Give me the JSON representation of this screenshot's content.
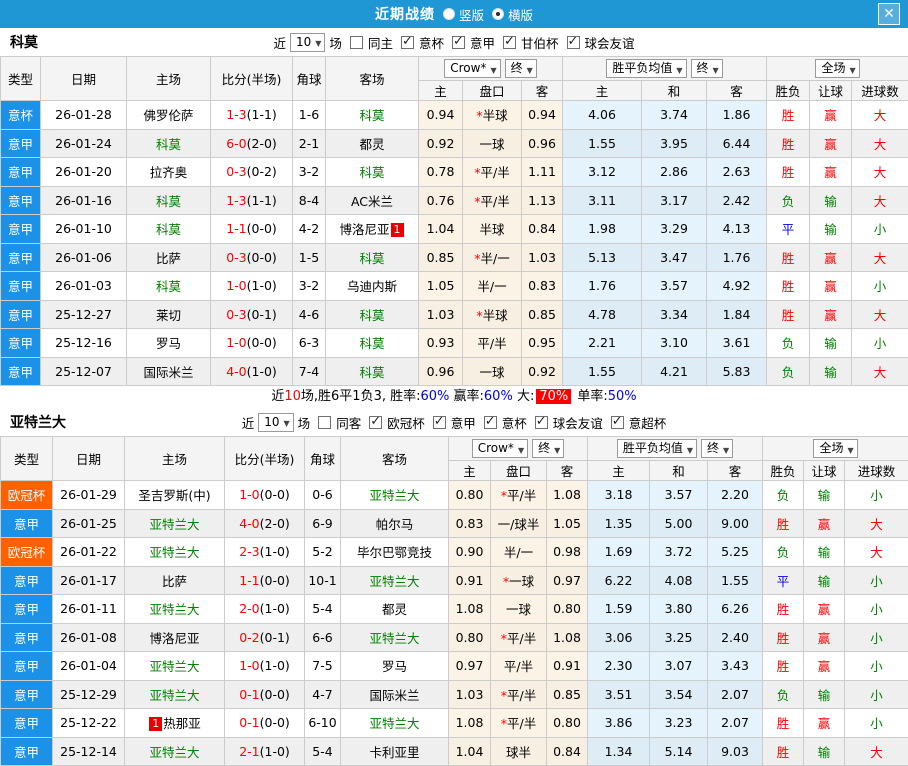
{
  "titlebar": {
    "title": "近期战绩",
    "radios": [
      {
        "label": "竖版",
        "selected": false
      },
      {
        "label": "横版",
        "selected": true
      }
    ],
    "close": "✕"
  },
  "colors": {
    "titlebar_bg": "#1e97d4",
    "header_bg": "#f4f4f4",
    "stripe_gray": "#efefef",
    "team_green": "#008000",
    "score_red": "#ff0000",
    "percent_blue": "#0000ee",
    "highlight_bg": "#ff0000",
    "league_colors": {
      "意杯": "#1b92e8",
      "意甲": "#1b92e8",
      "欧冠杯": "#ff6000"
    },
    "result_colors": {
      "胜": "#ff0000",
      "平": "#0000dd",
      "负": "#008000",
      "赢": "#ff0000",
      "输": "#008000",
      "大": "#ff0000",
      "小": "#008000"
    }
  },
  "table_header": {
    "type": "类型",
    "date": "日期",
    "home": "主场",
    "score": "比分(半场)",
    "corner": "角球",
    "away": "客场",
    "crow_select": "Crow*",
    "final_select": "终",
    "avg_select": "胜平负均值",
    "final2_select": "终",
    "fullmatch_select": "全场",
    "sub": [
      "主",
      "盘口",
      "客",
      "主",
      "和",
      "客",
      "胜负",
      "让球",
      "进球数"
    ]
  },
  "sections": [
    {
      "team": "科莫",
      "filter": {
        "near_label": "近",
        "count": "10",
        "matches_label": "场",
        "same_label": "同主",
        "same_checked": false,
        "leagues": [
          {
            "label": "意杯",
            "checked": true
          },
          {
            "label": "意甲",
            "checked": true
          },
          {
            "label": "甘伯杯",
            "checked": true
          },
          {
            "label": "球会友谊",
            "checked": true
          }
        ]
      },
      "rows": [
        {
          "lg": "意杯",
          "date": "26-01-28",
          "home": "佛罗伦萨",
          "score": "1-3",
          "half": "(1-1)",
          "corner": "1-6",
          "away": "科莫",
          "o1": "0.94",
          "star": "*",
          "hc": "半球",
          "o2": "0.94",
          "a1": "4.06",
          "a2": "3.74",
          "a3": "1.86",
          "res": "胜",
          "let": "赢",
          "goal": "大"
        },
        {
          "lg": "意甲",
          "date": "26-01-24",
          "home": "科莫",
          "score": "6-0",
          "half": "(2-0)",
          "corner": "2-1",
          "away": "都灵",
          "o1": "0.92",
          "star": "",
          "hc": "一球",
          "o2": "0.96",
          "a1": "1.55",
          "a2": "3.95",
          "a3": "6.44",
          "res": "胜",
          "let": "赢",
          "goal": "大"
        },
        {
          "lg": "意甲",
          "date": "26-01-20",
          "home": "拉齐奥",
          "score": "0-3",
          "half": "(0-2)",
          "corner": "3-2",
          "away": "科莫",
          "o1": "0.78",
          "star": "*",
          "hc": "平/半",
          "o2": "1.11",
          "a1": "3.12",
          "a2": "2.86",
          "a3": "2.63",
          "res": "胜",
          "let": "赢",
          "goal": "大"
        },
        {
          "lg": "意甲",
          "date": "26-01-16",
          "home": "科莫",
          "score": "1-3",
          "half": "(1-1)",
          "corner": "8-4",
          "away": "AC米兰",
          "o1": "0.76",
          "star": "*",
          "hc": "平/半",
          "o2": "1.13",
          "a1": "3.11",
          "a2": "3.17",
          "a3": "2.42",
          "res": "负",
          "let": "输",
          "goal": "大"
        },
        {
          "lg": "意甲",
          "date": "26-01-10",
          "home": "科莫",
          "score": "1-1",
          "half": "(0-0)",
          "corner": "4-2",
          "away": "博洛尼亚",
          "ab_post": "1",
          "o1": "1.04",
          "star": "",
          "hc": "半球",
          "o2": "0.84",
          "a1": "1.98",
          "a2": "3.29",
          "a3": "4.13",
          "res": "平",
          "let": "输",
          "goal": "小"
        },
        {
          "lg": "意甲",
          "date": "26-01-06",
          "home": "比萨",
          "score": "0-3",
          "half": "(0-0)",
          "corner": "1-5",
          "away": "科莫",
          "o1": "0.85",
          "star": "*",
          "hc": "半/一",
          "o2": "1.03",
          "a1": "5.13",
          "a2": "3.47",
          "a3": "1.76",
          "res": "胜",
          "let": "赢",
          "goal": "大"
        },
        {
          "lg": "意甲",
          "date": "26-01-03",
          "home": "科莫",
          "score": "1-0",
          "half": "(1-0)",
          "corner": "3-2",
          "away": "乌迪内斯",
          "o1": "1.05",
          "star": "",
          "hc": "半/一",
          "o2": "0.83",
          "a1": "1.76",
          "a2": "3.57",
          "a3": "4.92",
          "res": "胜",
          "let": "赢",
          "goal": "小"
        },
        {
          "lg": "意甲",
          "date": "25-12-27",
          "home": "莱切",
          "score": "0-3",
          "half": "(0-1)",
          "corner": "4-6",
          "away": "科莫",
          "o1": "1.03",
          "star": "*",
          "hc": "半球",
          "o2": "0.85",
          "a1": "4.78",
          "a2": "3.34",
          "a3": "1.84",
          "res": "胜",
          "let": "赢",
          "goal": "大"
        },
        {
          "lg": "意甲",
          "date": "25-12-16",
          "home": "罗马",
          "score": "1-0",
          "half": "(0-0)",
          "corner": "6-3",
          "away": "科莫",
          "o1": "0.93",
          "star": "",
          "hc": "平/半",
          "o2": "0.95",
          "a1": "2.21",
          "a2": "3.10",
          "a3": "3.61",
          "res": "负",
          "let": "输",
          "goal": "小"
        },
        {
          "lg": "意甲",
          "date": "25-12-07",
          "home": "国际米兰",
          "score": "4-0",
          "half": "(1-0)",
          "corner": "7-4",
          "away": "科莫",
          "o1": "0.96",
          "star": "",
          "hc": "一球",
          "o2": "0.92",
          "a1": "1.55",
          "a2": "4.21",
          "a3": "5.83",
          "res": "负",
          "let": "输",
          "goal": "大"
        }
      ],
      "summary": [
        {
          "t": "近",
          "s": "k"
        },
        {
          "t": "10",
          "s": "r"
        },
        {
          "t": "场,胜6平1负3, 胜率:",
          "s": "k"
        },
        {
          "t": "60%",
          "s": "b"
        },
        {
          "t": " 赢率:",
          "s": "k"
        },
        {
          "t": "60%",
          "s": "b"
        },
        {
          "t": " 大:",
          "s": "k"
        },
        {
          "t": "70%",
          "s": "hr"
        },
        {
          "t": " 单率:",
          "s": "k"
        },
        {
          "t": "50%",
          "s": "b"
        }
      ]
    },
    {
      "team": "亚特兰大",
      "filter": {
        "near_label": "近",
        "count": "10",
        "matches_label": "场",
        "same_label": "同客",
        "same_checked": false,
        "leagues": [
          {
            "label": "欧冠杯",
            "checked": true
          },
          {
            "label": "意甲",
            "checked": true
          },
          {
            "label": "意杯",
            "checked": true
          },
          {
            "label": "球会友谊",
            "checked": true
          },
          {
            "label": "意超杯",
            "checked": true
          }
        ]
      },
      "rows": [
        {
          "lg": "欧冠杯",
          "date": "26-01-29",
          "home": "圣吉罗斯(中)",
          "score": "1-0",
          "half": "(0-0)",
          "corner": "0-6",
          "away": "亚特兰大",
          "o1": "0.80",
          "star": "*",
          "hc": "平/半",
          "o2": "1.08",
          "a1": "3.18",
          "a2": "3.57",
          "a3": "2.20",
          "res": "负",
          "let": "输",
          "goal": "小"
        },
        {
          "lg": "意甲",
          "date": "26-01-25",
          "home": "亚特兰大",
          "score": "4-0",
          "half": "(2-0)",
          "corner": "6-9",
          "away": "帕尔马",
          "o1": "0.83",
          "star": "",
          "hc": "一/球半",
          "o2": "1.05",
          "a1": "1.35",
          "a2": "5.00",
          "a3": "9.00",
          "res": "胜",
          "let": "赢",
          "goal": "大"
        },
        {
          "lg": "欧冠杯",
          "date": "26-01-22",
          "home": "亚特兰大",
          "score": "2-3",
          "half": "(1-0)",
          "corner": "5-2",
          "away": "毕尔巴鄂竞技",
          "o1": "0.90",
          "star": "",
          "hc": "半/一",
          "o2": "0.98",
          "a1": "1.69",
          "a2": "3.72",
          "a3": "5.25",
          "res": "负",
          "let": "输",
          "goal": "大"
        },
        {
          "lg": "意甲",
          "date": "26-01-17",
          "home": "比萨",
          "score": "1-1",
          "half": "(0-0)",
          "corner": "10-1",
          "away": "亚特兰大",
          "o1": "0.91",
          "star": "*",
          "hc": "一球",
          "o2": "0.97",
          "a1": "6.22",
          "a2": "4.08",
          "a3": "1.55",
          "res": "平",
          "let": "输",
          "goal": "小"
        },
        {
          "lg": "意甲",
          "date": "26-01-11",
          "home": "亚特兰大",
          "score": "2-0",
          "half": "(1-0)",
          "corner": "5-4",
          "away": "都灵",
          "o1": "1.08",
          "star": "",
          "hc": "一球",
          "o2": "0.80",
          "a1": "1.59",
          "a2": "3.80",
          "a3": "6.26",
          "res": "胜",
          "let": "赢",
          "goal": "小"
        },
        {
          "lg": "意甲",
          "date": "26-01-08",
          "home": "博洛尼亚",
          "score": "0-2",
          "half": "(0-1)",
          "corner": "6-6",
          "away": "亚特兰大",
          "o1": "0.80",
          "star": "*",
          "hc": "平/半",
          "o2": "1.08",
          "a1": "3.06",
          "a2": "3.25",
          "a3": "2.40",
          "res": "胜",
          "let": "赢",
          "goal": "小"
        },
        {
          "lg": "意甲",
          "date": "26-01-04",
          "home": "亚特兰大",
          "score": "1-0",
          "half": "(1-0)",
          "corner": "7-5",
          "away": "罗马",
          "o1": "0.97",
          "star": "",
          "hc": "平/半",
          "o2": "0.91",
          "a1": "2.30",
          "a2": "3.07",
          "a3": "3.43",
          "res": "胜",
          "let": "赢",
          "goal": "小"
        },
        {
          "lg": "意甲",
          "date": "25-12-29",
          "home": "亚特兰大",
          "score": "0-1",
          "half": "(0-0)",
          "corner": "4-7",
          "away": "国际米兰",
          "o1": "1.03",
          "star": "*",
          "hc": "平/半",
          "o2": "0.85",
          "a1": "3.51",
          "a2": "3.54",
          "a3": "2.07",
          "res": "负",
          "let": "输",
          "goal": "小"
        },
        {
          "lg": "意甲",
          "date": "25-12-22",
          "home": "热那亚",
          "hb_pre": "1",
          "score": "0-1",
          "half": "(0-0)",
          "corner": "6-10",
          "away": "亚特兰大",
          "o1": "1.08",
          "star": "*",
          "hc": "平/半",
          "o2": "0.80",
          "a1": "3.86",
          "a2": "3.23",
          "a3": "2.07",
          "res": "胜",
          "let": "赢",
          "goal": "小"
        },
        {
          "lg": "意甲",
          "date": "25-12-14",
          "home": "亚特兰大",
          "score": "2-1",
          "half": "(1-0)",
          "corner": "5-4",
          "away": "卡利亚里",
          "o1": "1.04",
          "star": "",
          "hc": "球半",
          "o2": "0.84",
          "a1": "1.34",
          "a2": "5.14",
          "a3": "9.03",
          "res": "胜",
          "let": "输",
          "goal": "大"
        }
      ]
    }
  ]
}
